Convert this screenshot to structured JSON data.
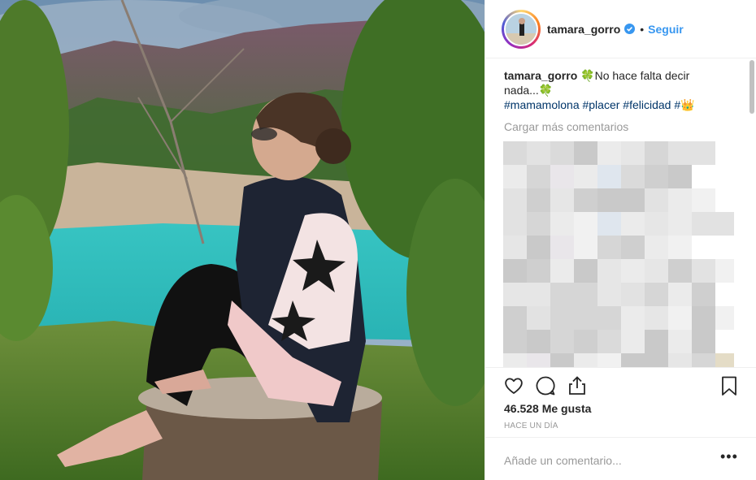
{
  "post": {
    "username": "tamara_gorro",
    "separator": "•",
    "follow_label": "Seguir",
    "verified_icon": "verified-badge-icon"
  },
  "caption": {
    "username": "tamara_gorro",
    "text_line1": "🍀No hace falta decir",
    "text_line2": "nada...🍀",
    "hashtags": "#mamamolona #placer #felicidad #👑"
  },
  "comments": {
    "load_more_label": "Cargar más comentarios"
  },
  "actions": {
    "like_icon": "heart-icon",
    "comment_icon": "comment-bubble-icon",
    "share_icon": "share-icon",
    "save_icon": "bookmark-icon"
  },
  "stats": {
    "likes_label": "46.528 Me gusta",
    "time_label": "HACE UN DÍA"
  },
  "add_comment": {
    "placeholder": "Añade un comentario...",
    "more_label": "•••"
  },
  "colors": {
    "accent_blue": "#3897f0",
    "hashtag": "#003569",
    "muted": "#999999",
    "border": "#efefef"
  }
}
